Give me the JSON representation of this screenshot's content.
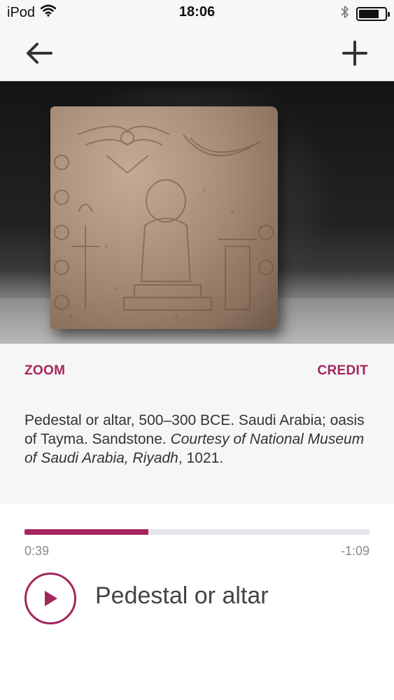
{
  "status_bar": {
    "carrier": "iPod",
    "time": "18:06",
    "icons": [
      "wifi-icon",
      "bluetooth-icon",
      "battery-icon"
    ]
  },
  "nav": {
    "back_icon": "arrow-left-icon",
    "add_icon": "plus-icon"
  },
  "artwork": {
    "image": "photo of carved sandstone pedestal relief"
  },
  "caption": {
    "zoom_label": "ZOOM",
    "credit_label": "CREDIT",
    "text_plain": "Pedestal or altar, 500–300 BCE. Saudi Arabia; oasis of Tayma. Sandstone. ",
    "text_italic": "Courtesy of National Museum of Saudi Arabia, Riyadh",
    "text_end": ", 1021."
  },
  "player": {
    "progress": 0.36,
    "elapsed": "0:39",
    "remaining": "-1:09",
    "play_icon": "play-icon",
    "title": "Pedestal or altar"
  },
  "colors": {
    "accent": "#a3265c",
    "track": "#e6e6ea"
  }
}
